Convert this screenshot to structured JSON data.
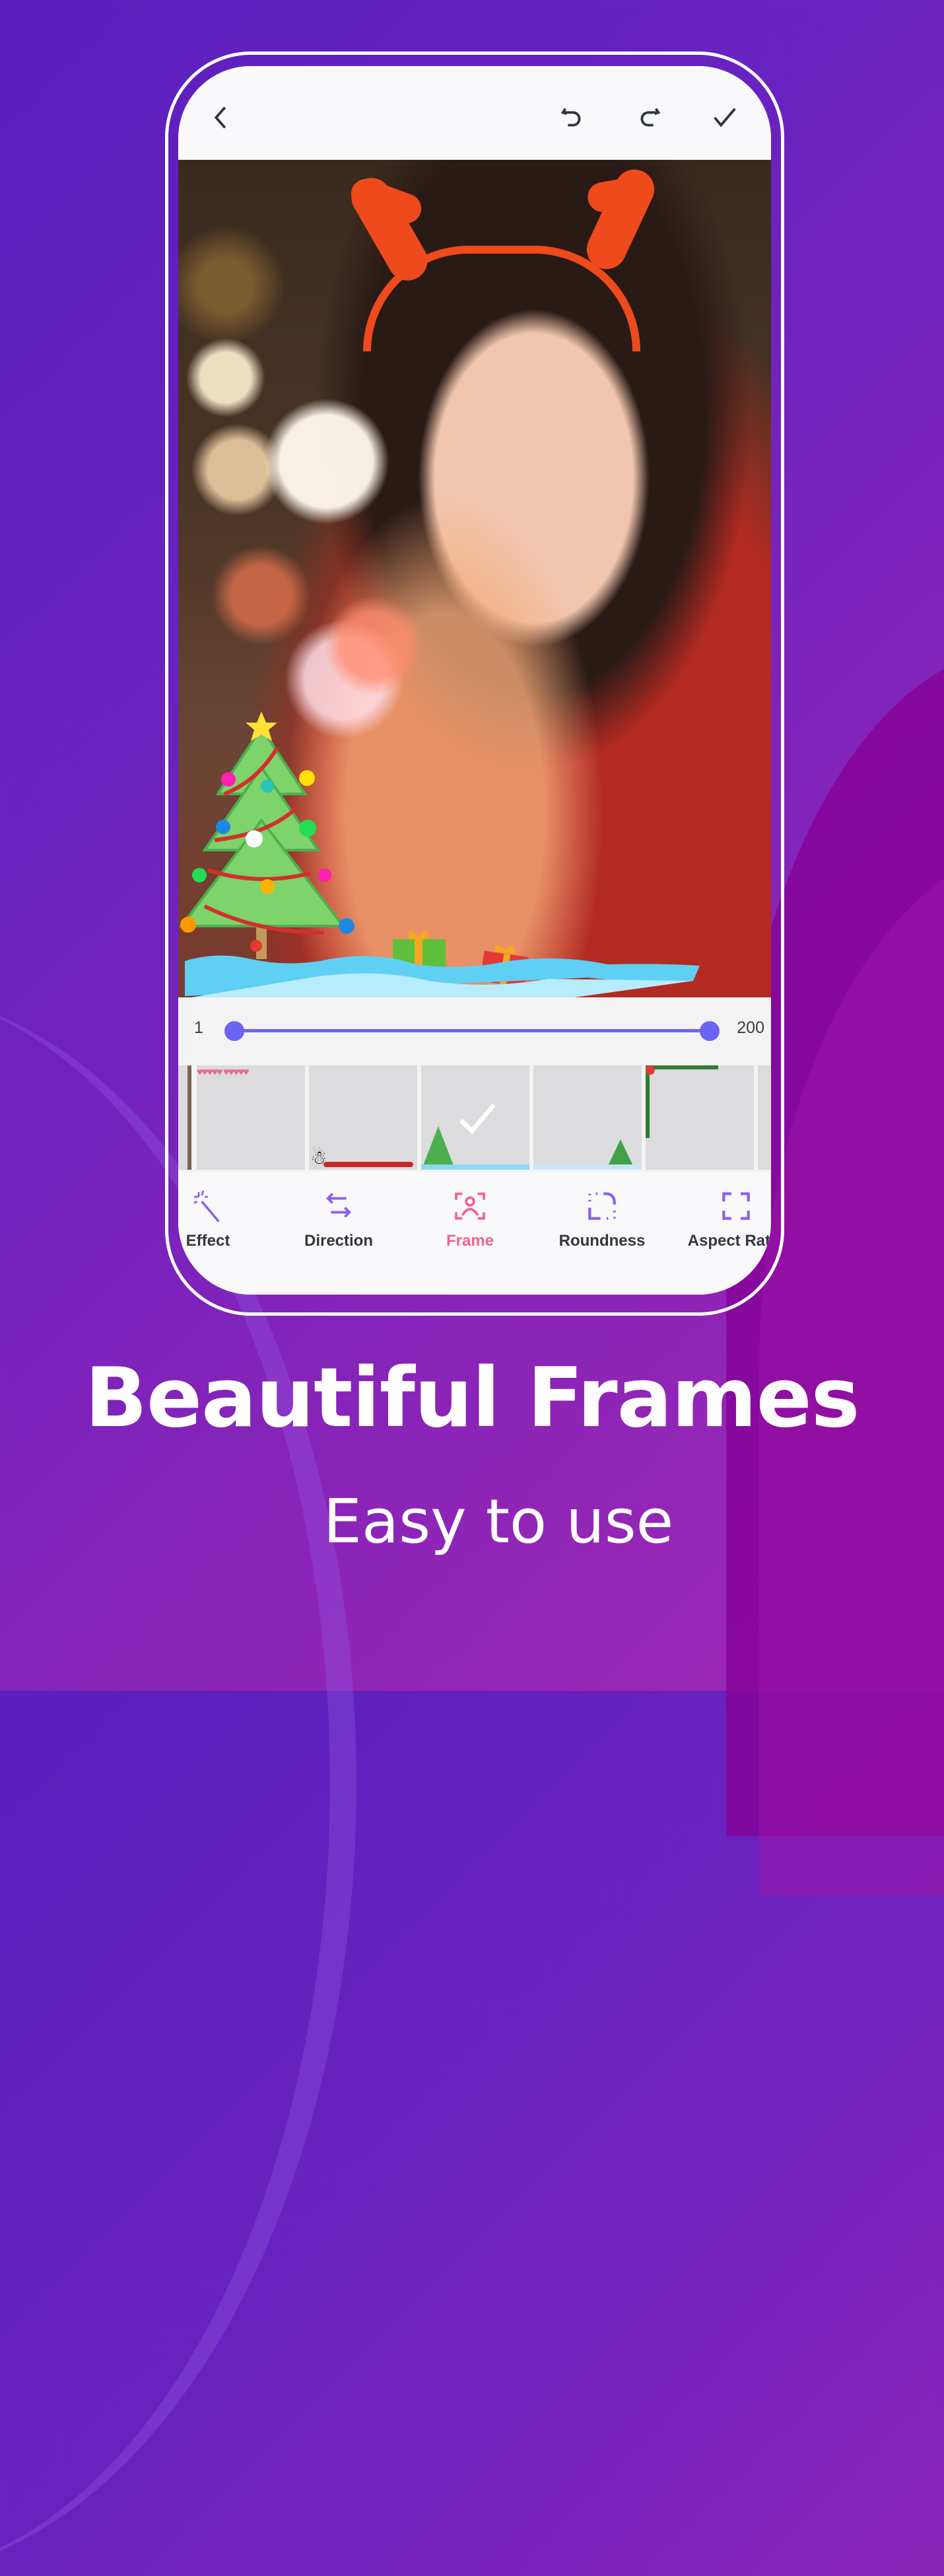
{
  "colors": {
    "accent_slider": "#6b63f5",
    "active_tab": "#f06292",
    "icon_purple": "#8b5cf6",
    "text_dark": "#33363f"
  },
  "topbar": {
    "icons": [
      "back-icon",
      "undo-icon",
      "redo-icon",
      "check-icon"
    ]
  },
  "slider": {
    "min_label": "1",
    "max_label": "200",
    "range_low": 1,
    "range_high": 200
  },
  "frames": {
    "items": [
      {
        "name": "hearts-frame",
        "selected": false
      },
      {
        "name": "snowman-garland-frame",
        "selected": false
      },
      {
        "name": "christmas-tree-snow-frame",
        "selected": true
      },
      {
        "name": "small-tree-frame",
        "selected": false
      },
      {
        "name": "holly-corner-frame",
        "selected": false
      }
    ]
  },
  "toolbar": {
    "items": [
      {
        "label": "Effect",
        "icon": "magic-wand-icon",
        "active": false
      },
      {
        "label": "Direction",
        "icon": "swap-arrows-icon",
        "active": false
      },
      {
        "label": "Frame",
        "icon": "person-frame-icon",
        "active": true
      },
      {
        "label": "Roundness",
        "icon": "roundness-corner-icon",
        "active": false
      },
      {
        "label": "Aspect Ratio",
        "icon": "aspect-ratio-icon",
        "active": false
      }
    ]
  },
  "promo": {
    "headline": "Beautiful Frames",
    "subline": "Easy to use"
  }
}
